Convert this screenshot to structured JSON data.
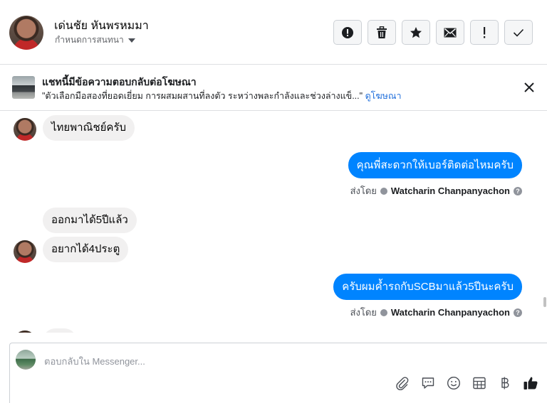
{
  "header": {
    "contact_name": "เด่นชัย หันพรหมมา",
    "subtitle": "กำหนดการสนทนา",
    "actions": [
      {
        "name": "alert-icon"
      },
      {
        "name": "trash-icon"
      },
      {
        "name": "star-icon"
      },
      {
        "name": "mail-icon"
      },
      {
        "name": "exclamation-icon"
      },
      {
        "name": "check-icon"
      }
    ]
  },
  "ad_banner": {
    "title": "แชทนี้มีข้อความตอบกลับต่อโฆษณา",
    "quote": "\"ตัวเลือกมือสองที่ยอดเยี่ยม การผสมผสานที่ลงตัว ระหว่างพละกำลังและช่วงล่างแข็...\"",
    "link": "ดูโฆษณา"
  },
  "messages": [
    {
      "side": "in",
      "text": "ไทยพาณิชย์ครับ"
    },
    {
      "side": "out",
      "text": "คุณพี่สะดวกให้เบอร์ติดต่อไหมครับ",
      "sent_by_label": "ส่งโดย",
      "sender": "Watcharin Chanpanyachon"
    },
    {
      "side": "in",
      "text": "ออกมาได้5ปีแล้ว"
    },
    {
      "side": "in",
      "text": "อยากได้4ประตู"
    },
    {
      "side": "out",
      "text": "ครับผมค้ำรถกับSCBมาแล้ว5ปีนะครับ",
      "sent_by_label": "ส่งโดย",
      "sender": "Watcharin Chanpanyachon"
    }
  ],
  "composer": {
    "placeholder": "ตอบกลับใน Messenger...",
    "tools": [
      "attach-icon",
      "saved-reply-icon",
      "emoji-icon",
      "table-icon",
      "baht-icon",
      "like-icon"
    ]
  },
  "colors": {
    "outgoing_bubble": "#0084ff",
    "incoming_bubble": "#f1f0f0",
    "link": "#216fdb"
  }
}
